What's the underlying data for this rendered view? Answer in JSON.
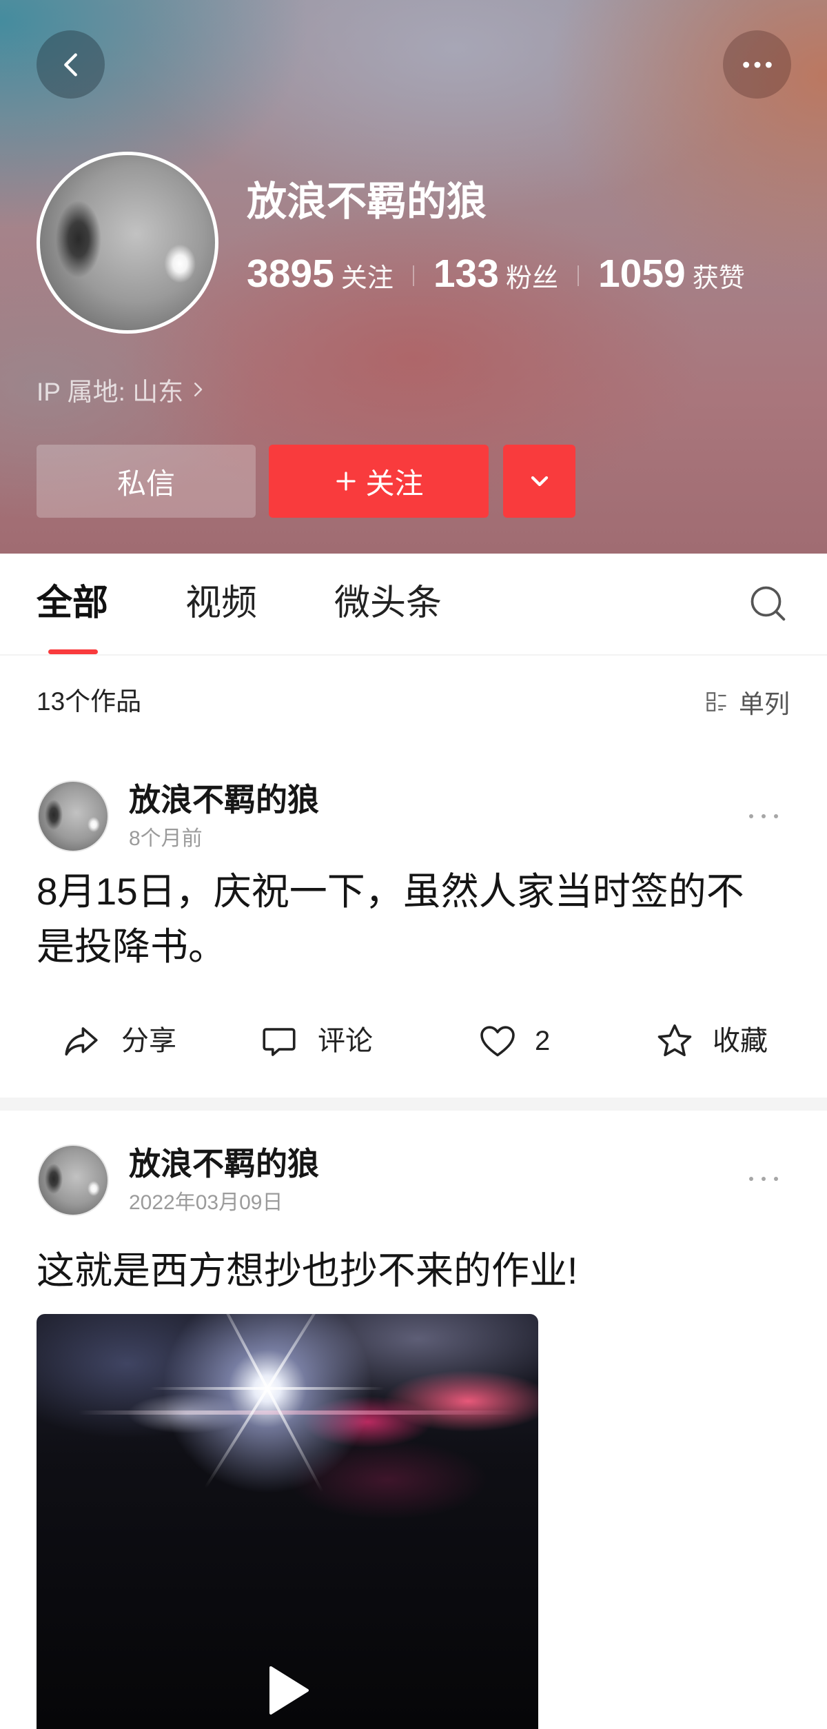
{
  "profile": {
    "name": "放浪不羁的狼",
    "stats": [
      {
        "value": "3895",
        "label": "关注"
      },
      {
        "value": "133",
        "label": "粉丝"
      },
      {
        "value": "1059",
        "label": "获赞"
      }
    ],
    "ip_location": "IP 属地: 山东"
  },
  "actions": {
    "message_label": "私信",
    "follow_label": "关注"
  },
  "tabs": [
    {
      "label": "全部",
      "active": true
    },
    {
      "label": "视频",
      "active": false
    },
    {
      "label": "微头条",
      "active": false
    }
  ],
  "works": {
    "count_label": "13个作品",
    "layout_label": "单列"
  },
  "posts": [
    {
      "author": "放浪不羁的狼",
      "time": "8个月前",
      "text": "8月15日，庆祝一下，虽然人家当时签的不是投降书。",
      "share_label": "分享",
      "comment_label": "评论",
      "like_count": "2",
      "favorite_label": "收藏"
    },
    {
      "author": "放浪不羁的狼",
      "time": "2022年03月09日",
      "text": "这就是西方想抄也抄不来的作业!",
      "media_icon": "play-icon"
    }
  ],
  "icons": {
    "back": "chevron-left-icon",
    "more": "more-icon",
    "ip_arrow": "chevron-right-icon",
    "follow": "plus-icon",
    "dropdown": "chevron-down-icon",
    "search": "search-icon",
    "layout": "list-layout-icon",
    "share": "share-icon",
    "comment": "comment-icon",
    "like": "heart-icon",
    "favorite": "star-icon",
    "post_menu": "ellipsis-icon"
  },
  "colors": {
    "accent": "#f93b3d",
    "text": "#1c1c1c",
    "muted": "#9b9b9b",
    "divider": "#f4f4f4"
  }
}
